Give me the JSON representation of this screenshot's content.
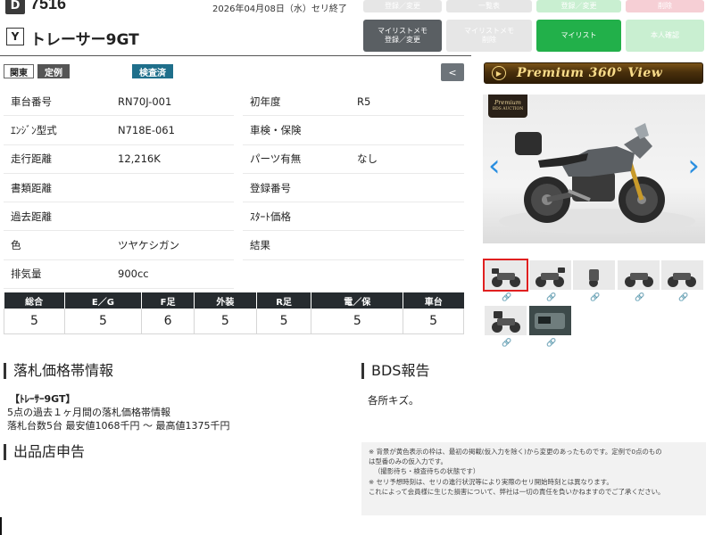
{
  "header": {
    "lot_badge": "D",
    "lot_number": "7516",
    "end_date": "2026年04月08日（水）セリ終了",
    "maker_badge": "Y",
    "model_name": "トレーサー9GT"
  },
  "top_buttons": {
    "row1": [
      "登録／変更",
      "一覧表",
      "登録／変更",
      "削除"
    ],
    "mylist_memo_register": "マイリストメモ\n登録／変更",
    "mylist_memo_delete": "マイリストメモ\n削除",
    "mylist": "マイリスト",
    "personal_confirm": "本人確認"
  },
  "tags": {
    "region": "関東",
    "regular": "定例",
    "inspection": "検査済",
    "collapse": "<"
  },
  "specs": [
    {
      "label": "車台番号",
      "value": "RN70J-001",
      "label2": "初年度",
      "value2": "R5"
    },
    {
      "label": "ｴﾝｼﾞﾝ型式",
      "value": "N718E-061",
      "label2": "車検・保険",
      "value2": ""
    },
    {
      "label": "走行距離",
      "value": "12,216K",
      "label2": "パーツ有無",
      "value2": "なし"
    },
    {
      "label": "書類距離",
      "value": "",
      "label2": "登録番号",
      "value2": ""
    },
    {
      "label": "過去距離",
      "value": "",
      "label2": "ｽﾀｰﾄ価格",
      "value2": ""
    },
    {
      "label": "色",
      "value": "ツヤケシガン",
      "label2": "結果",
      "value2": ""
    },
    {
      "label": "排気量",
      "value": "900cc",
      "label2": null,
      "value2": null
    }
  ],
  "scores": {
    "headers": [
      "総合",
      "E／G",
      "F足",
      "外装",
      "R足",
      "電／保",
      "車台"
    ],
    "values": [
      "5",
      "5",
      "6",
      "5",
      "5",
      "5",
      "5"
    ]
  },
  "bid_section": {
    "title": "落札価格帯情報",
    "model_line": "【ﾄﾚｰｻｰ9GT】",
    "period_line": "5点の過去１ヶ月間の落札価格帯情報",
    "count_line": "落札台数5台 最安値1068千円 〜 最高値1375千円"
  },
  "bds_section": {
    "title": "BDS報告",
    "text": "各所キズ。"
  },
  "seller_section": {
    "title": "出品店申告"
  },
  "notice": {
    "line1": "※ 背景が黄色表示の枠は、最初の掲載(仮入力を除く)から変更のあったものです。定例で0点のもの",
    "line2": "は型番のみの仮入力です。",
    "line3": "（撮影待ち・検査待ちの状態です）",
    "line4": "※ セリ予想時刻は、セリの進行状況等により実際のセリ開始時刻とは異なります。",
    "line5": "これによって会員様に生じた損害について、弊社は一切の責任を負いかねますのでご了承ください。"
  },
  "premium_banner": "Premium 360° View",
  "premium_logo": {
    "line1": "Premium",
    "line2": "BDS AUCTION"
  },
  "photos": {
    "prev": "‹",
    "next": "›",
    "thumbnail_count": 7,
    "selected_index": 0
  },
  "colors": {
    "accent_green": "#22b04a",
    "inspect_teal": "#1f6f8b",
    "score_header": "#262b2f",
    "arrow_blue": "#2b8fe0",
    "selected_red": "#e02020"
  }
}
